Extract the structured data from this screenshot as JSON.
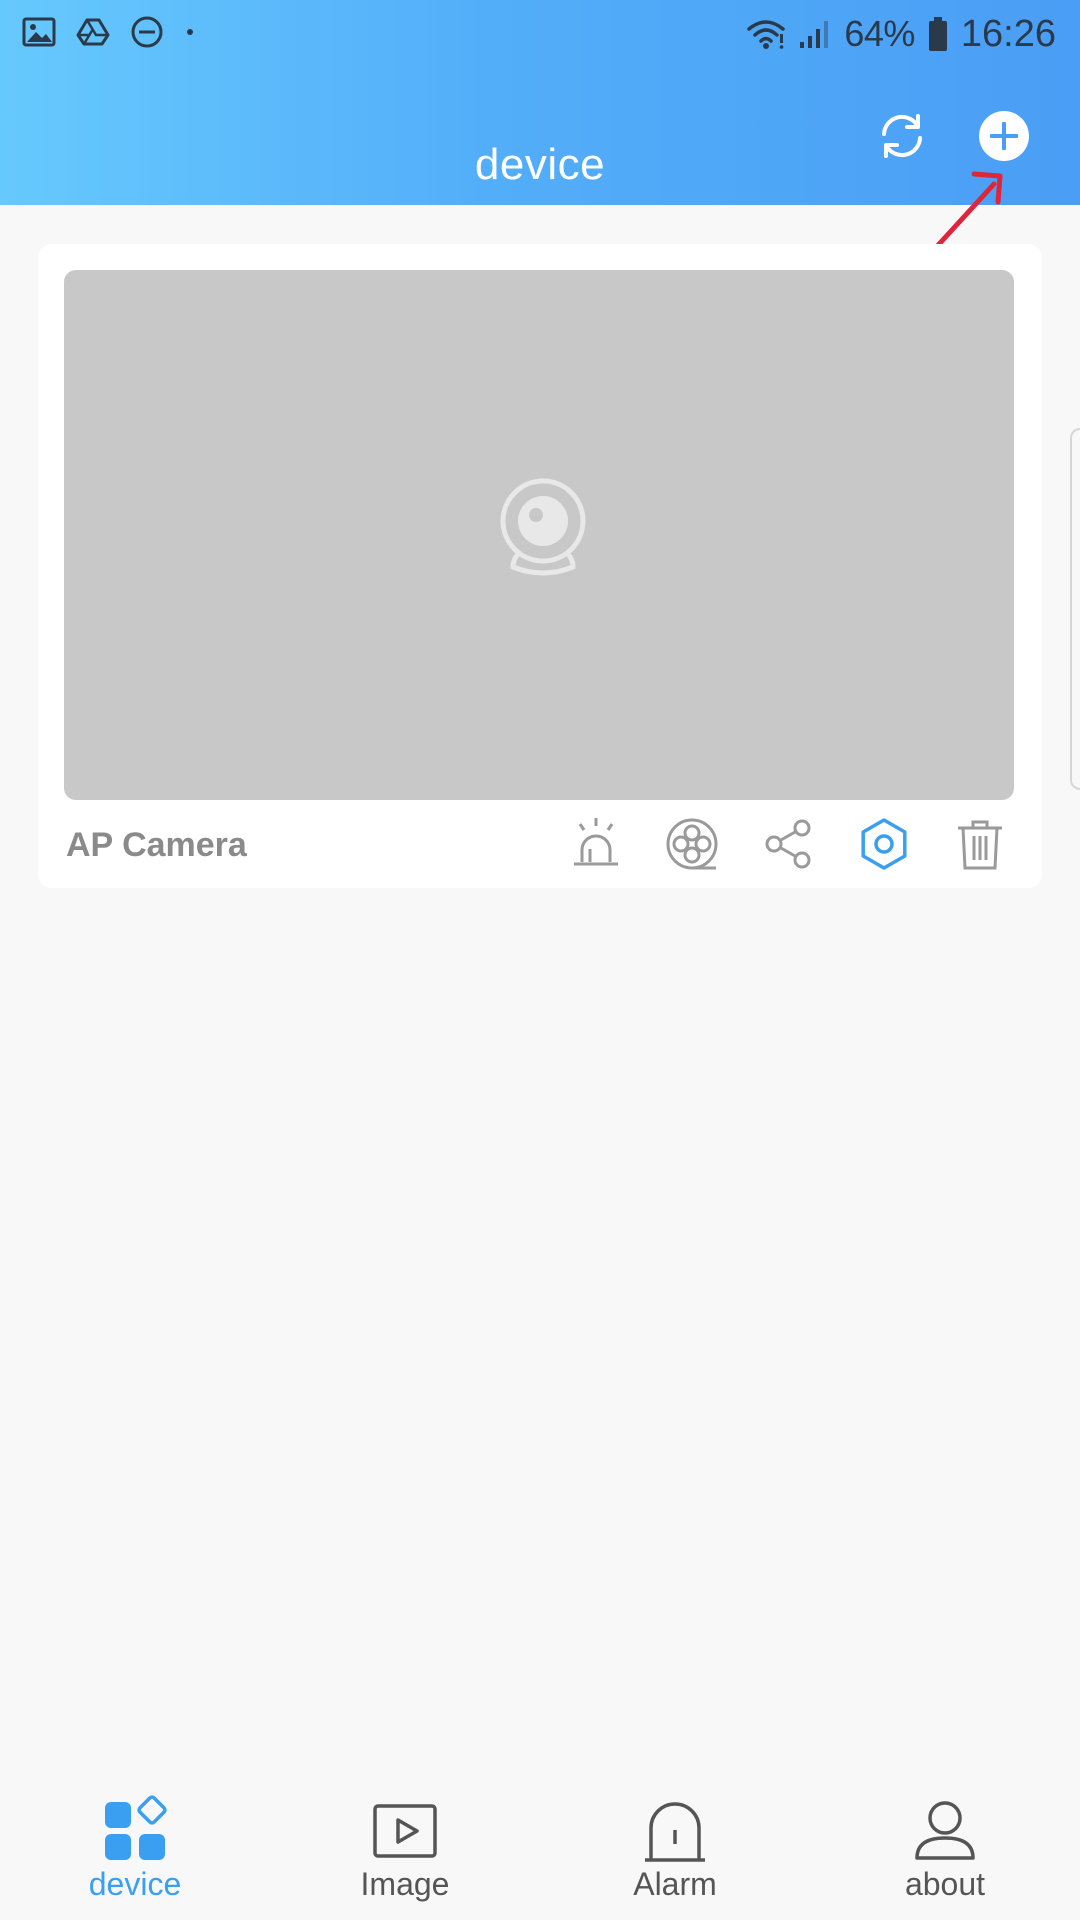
{
  "statusbar": {
    "battery": "64%",
    "time": "16:26"
  },
  "header": {
    "title": "device"
  },
  "device_card": {
    "name": "AP Camera"
  },
  "bottom_nav": {
    "items": [
      {
        "label": "device",
        "active": true
      },
      {
        "label": "Image",
        "active": false
      },
      {
        "label": "Alarm",
        "active": false
      },
      {
        "label": "about",
        "active": false
      }
    ]
  },
  "colors": {
    "header_start": "#66c9fd",
    "header_end": "#4a9ef5",
    "accent": "#3a9ff1",
    "annotation_arrow": "#e0243c",
    "preview_bg": "#c8c8c8"
  }
}
